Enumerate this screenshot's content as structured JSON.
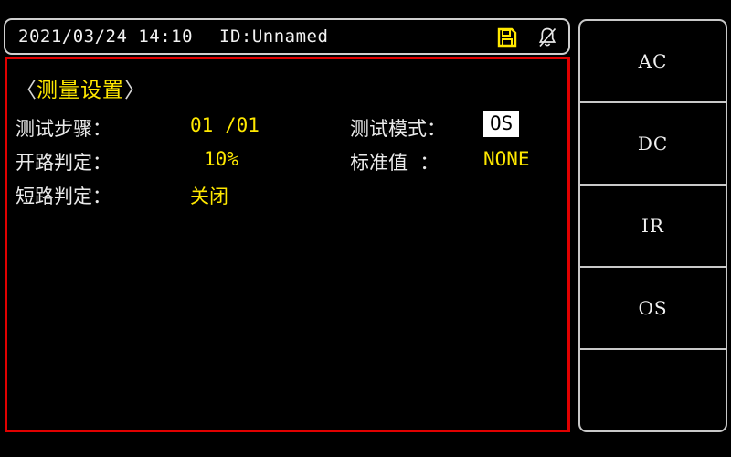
{
  "statusbar": {
    "datetime": "2021/03/24 14:10",
    "device_id": "ID:Unnamed",
    "icons": [
      {
        "name": "save-icon",
        "glyph": "save",
        "color": "#ffe800"
      },
      {
        "name": "alarm-muted-icon",
        "glyph": "bell-slash",
        "color": "#e6e6e6"
      }
    ]
  },
  "page": {
    "chevron_left": "〈",
    "title": "测量设置",
    "chevron_right": "〉",
    "border_color": "#e00000"
  },
  "fields": {
    "test_step": {
      "label": "测试步骤：",
      "value": "01 /01"
    },
    "open_judge": {
      "label": "开路判定：",
      "value": "10%"
    },
    "short_judge": {
      "label": "短路判定：",
      "value": "关闭"
    },
    "test_mode": {
      "label": "测试模式：",
      "value": "OS",
      "selected": true
    },
    "standard_value": {
      "label": "标准值  ：",
      "value": "NONE"
    }
  },
  "sidebar": {
    "keys": [
      {
        "label": "AC"
      },
      {
        "label": "DC"
      },
      {
        "label": "IR"
      },
      {
        "label": "OS"
      },
      {
        "label": ""
      }
    ]
  }
}
